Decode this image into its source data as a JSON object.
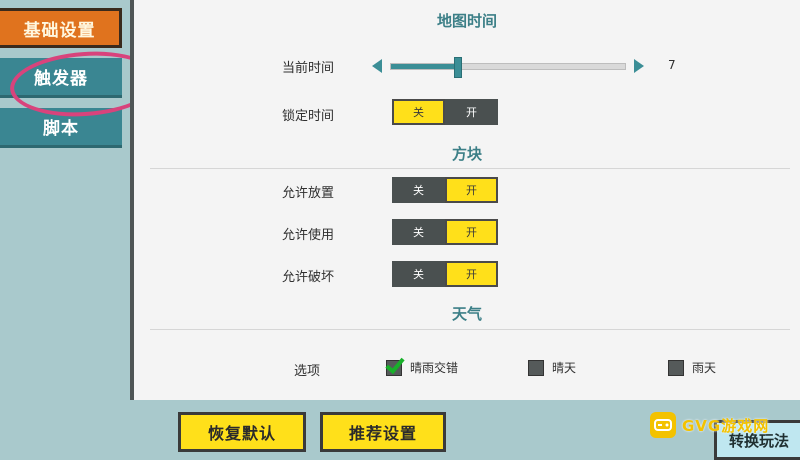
{
  "sidebar": {
    "tabs": [
      {
        "label": "基础设置",
        "active": true
      },
      {
        "label": "触发器",
        "active": false
      },
      {
        "label": "脚本",
        "active": false
      }
    ]
  },
  "sections": {
    "map_time": "地图时间",
    "block": "方块",
    "weather": "天气"
  },
  "settings": {
    "current_time": {
      "label": "当前时间",
      "value": "7",
      "fraction": 0.28
    },
    "lock_time": {
      "label": "锁定时间",
      "off": "关",
      "on": "开",
      "state": "off"
    },
    "allow_place": {
      "label": "允许放置",
      "off": "关",
      "on": "开",
      "state": "on"
    },
    "allow_use": {
      "label": "允许使用",
      "off": "关",
      "on": "开",
      "state": "on"
    },
    "allow_break": {
      "label": "允许破坏",
      "off": "关",
      "on": "开",
      "state": "on"
    }
  },
  "weather": {
    "label": "选项",
    "options": [
      {
        "label": "晴雨交错",
        "checked": true
      },
      {
        "label": "晴天",
        "checked": false
      },
      {
        "label": "雨天",
        "checked": false
      }
    ]
  },
  "buttons": {
    "restore_default": "恢复默认",
    "recommended": "推荐设置",
    "switch_mode": "转换玩法"
  },
  "watermark": {
    "text": "GVG游戏网"
  },
  "colors": {
    "accent_teal": "#3b8e96",
    "toggle_on": "#ffe01a",
    "active_tab": "#e0731e",
    "annotation": "#d8437c"
  }
}
